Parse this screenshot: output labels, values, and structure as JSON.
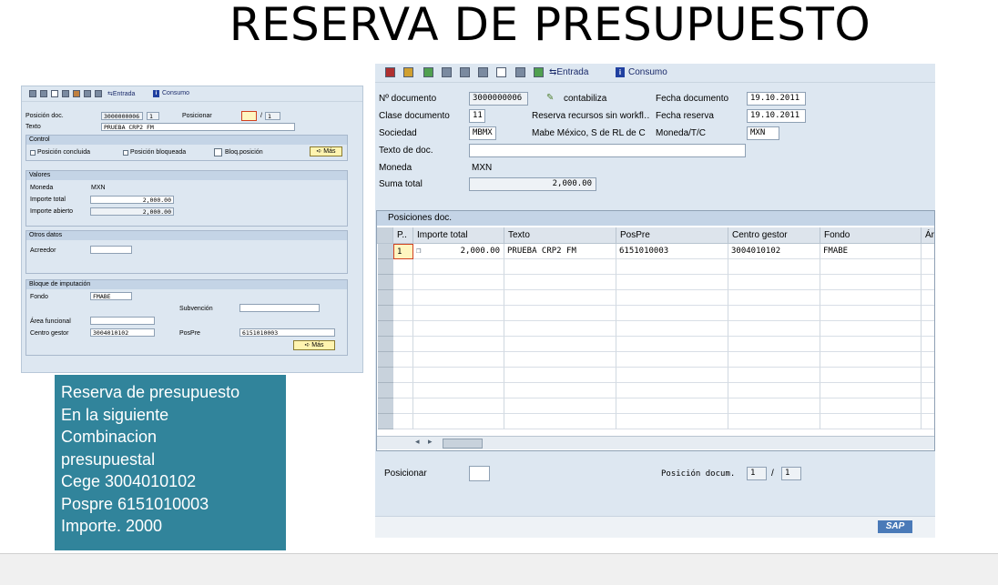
{
  "title": "RESERVA DE PRESUPUESTO",
  "left_screen": {
    "toolbar": {
      "entrada": "Entrada",
      "consumo": "Consumo"
    },
    "posicion_doc_label": "Posición doc.",
    "posicion_doc_value": "3000000006",
    "posicion_doc_item": "1",
    "posicionar_label": "Posicionar",
    "posicionar_sep": "/",
    "posicionar_total": "1",
    "texto_label": "Texto",
    "texto_value": "PRUEBA CRP2 FM",
    "control": {
      "header": "Control",
      "pos_concluida": "Posición concluida",
      "pos_bloqueada": "Posición bloqueada",
      "bloq_posicion": "Bloq.posición",
      "mas": "Más"
    },
    "valores": {
      "header": "Valores",
      "moneda_label": "Moneda",
      "moneda_value": "MXN",
      "importe_total_label": "Importe total",
      "importe_total_value": "2,000.00",
      "importe_abierto_label": "Importe abierto",
      "importe_abierto_value": "2,000.00"
    },
    "otros": {
      "header": "Otros datos",
      "acreedor_label": "Acreedor",
      "acreedor_value": ""
    },
    "bloque": {
      "header": "Bloque de imputación",
      "fondo_label": "Fondo",
      "fondo_value": "FMABE",
      "subvencion_label": "Subvención",
      "area_label": "Área funcional",
      "centro_label": "Centro gestor",
      "centro_value": "3004010102",
      "pospre_label": "PosPre",
      "pospre_value": "6151010003",
      "mas": "Más"
    }
  },
  "right_screen": {
    "toolbar": {
      "entrada": "Entrada",
      "consumo": "Consumo"
    },
    "header_fields": {
      "num_doc_label": "Nº documento",
      "num_doc_value": "3000000006",
      "contabiliza": "contabiliza",
      "fecha_doc_label": "Fecha documento",
      "fecha_doc_value": "19.10.2011",
      "clase_doc_label": "Clase documento",
      "clase_doc_value": "11",
      "clase_doc_desc": "Reserva recursos sin workfl…",
      "fecha_reserva_label": "Fecha reserva",
      "fecha_reserva_value": "19.10.2011",
      "sociedad_label": "Sociedad",
      "sociedad_value": "MBMX",
      "sociedad_desc": "Mabe México, S de RL de C",
      "moneda_tc_label": "Moneda/T/C",
      "moneda_tc_value": "MXN",
      "texto_doc_label": "Texto de doc.",
      "texto_doc_value": "",
      "moneda_label": "Moneda",
      "moneda_value": "MXN",
      "suma_total_label": "Suma total",
      "suma_total_value": "2,000.00"
    },
    "table": {
      "title": "Posiciones doc.",
      "columns": [
        "P..",
        "Importe total",
        "Texto",
        "PosPre",
        "Centro gestor",
        "Fondo",
        "Ár"
      ],
      "rows": [
        {
          "pos": "1",
          "importe": "2,000.00",
          "texto": "PRUEBA CRP2 FM",
          "pospre": "6151010003",
          "centro": "3004010102",
          "fondo": "FMABE"
        }
      ]
    },
    "footer": {
      "posicionar_label": "Posicionar",
      "posicion_docum_label": "Posición docum.",
      "pos_current": "1",
      "pos_sep": "/",
      "pos_total": "1"
    },
    "sap_logo": "SAP"
  },
  "note": {
    "lines": [
      "Reserva de presupuesto",
      "En la siguiente",
      "Combinacion",
      "presupuestal",
      "Cege 3004010102",
      "Pospre 6151010003",
      "Importe.  2000"
    ]
  },
  "colors": {
    "note_bg": "#31849b",
    "sap_bg": "#dde7f1",
    "sap_header": "#c4d4e6"
  }
}
